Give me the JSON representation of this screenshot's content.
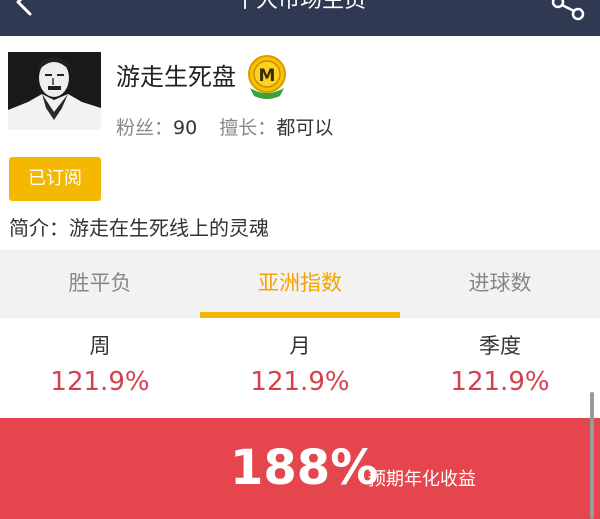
{
  "nav": {
    "title": "十大市场主员"
  },
  "profile": {
    "name": "游走生死盘",
    "badge_letter": "M",
    "fans_label": "粉丝：",
    "fans_value": "90",
    "specialty_label": "擅长：",
    "specialty_value": "都可以",
    "subscribe_label": "已订阅",
    "intro_label": "简介：",
    "intro_text": "游走在生死线上的灵魂"
  },
  "tabs": [
    {
      "label": "胜平负",
      "active": false
    },
    {
      "label": "亚洲指数",
      "active": true
    },
    {
      "label": "进球数",
      "active": false
    }
  ],
  "stats": [
    {
      "label": "周",
      "value": "121.9%"
    },
    {
      "label": "月",
      "value": "121.9%"
    },
    {
      "label": "季度",
      "value": "121.9%"
    }
  ],
  "banner": {
    "value": "188%",
    "caption": "预期年化收益"
  },
  "colors": {
    "nav_bg": "#2f3a52",
    "accent_yellow": "#f5b800",
    "tab_active_text": "#f5a300",
    "stat_value_red": "#d4414d",
    "banner_red": "#e5454c"
  }
}
